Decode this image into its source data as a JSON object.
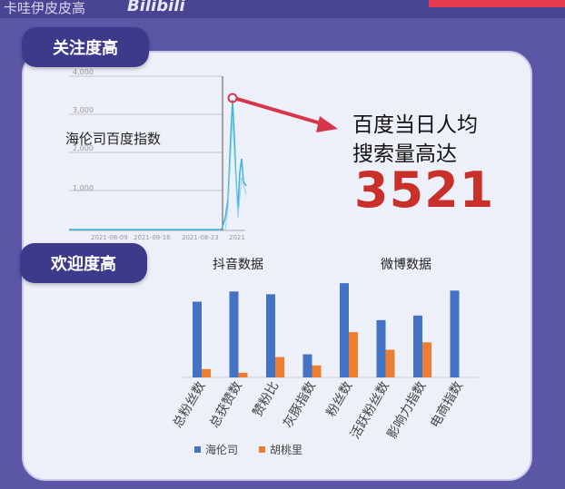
{
  "header": {
    "title": "卡哇伊皮皮高",
    "logo": "Bilibili"
  },
  "badges": {
    "attention": "关注度高",
    "popular": "欢迎度高"
  },
  "baidu": {
    "label": "海伦司百度指数",
    "yticks": [
      "4,000",
      "3,000",
      "2,000",
      "1,000"
    ],
    "xticks": [
      "2021-08-09",
      "2021-08-16",
      "2021-08-23",
      "2021"
    ],
    "headline_line1": "百度当日人均",
    "headline_line2": "搜索量高达",
    "peak_value": "3521"
  },
  "chart_data": {
    "type": "bar",
    "categories": [
      "总粉丝数",
      "总获赞数",
      "赞粉比",
      "灰豚指数",
      "粉丝数",
      "活跃粉丝数",
      "影响力指数",
      "电商指数"
    ],
    "group_labels": [
      "抖音数据",
      "微博数据"
    ],
    "series": [
      {
        "name": "海伦司",
        "values": [
          82,
          93,
          90,
          25,
          102,
          62,
          67,
          94
        ]
      },
      {
        "name": "胡桃里",
        "values": [
          9,
          5,
          22,
          13,
          49,
          30,
          38,
          0
        ]
      }
    ],
    "ylim": [
      0,
      110
    ],
    "grid": false,
    "legend": "bottom",
    "colors": [
      "#4472c4",
      "#ed7d31"
    ]
  }
}
